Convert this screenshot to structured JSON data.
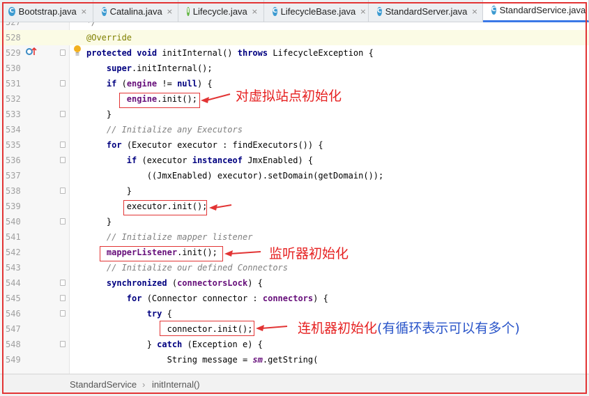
{
  "tabs": [
    {
      "label": "Bootstrap.java",
      "kind": "class"
    },
    {
      "label": "Catalina.java",
      "kind": "class"
    },
    {
      "label": "Lifecycle.java",
      "kind": "interface"
    },
    {
      "label": "LifecycleBase.java",
      "kind": "class"
    },
    {
      "label": "StandardServer.java",
      "kind": "class"
    },
    {
      "label": "StandardService.java",
      "kind": "class",
      "active": true
    }
  ],
  "lines": [
    {
      "n": "527",
      "html": "<span class=\"cm\">*/</span>"
    },
    {
      "n": "528",
      "html": "<span class=\"an\">@Override</span>",
      "hl": true
    },
    {
      "n": "529",
      "html": "<span class=\"kw\">protected void</span> initInternal() <span class=\"kw\">throws</span> LifecycleException {"
    },
    {
      "n": "530",
      "html": "    <span class=\"kw\">super</span>.initInternal();"
    },
    {
      "n": "531",
      "html": "    <span class=\"kw\">if</span> (<span class=\"fd\">engine</span> != <span class=\"kw\">null</span>) {"
    },
    {
      "n": "532",
      "html": "        <span class=\"fd\">engine</span>.init();"
    },
    {
      "n": "533",
      "html": "    }"
    },
    {
      "n": "534",
      "html": "    <span class=\"cm\">// Initialize any Executors</span>"
    },
    {
      "n": "535",
      "html": "    <span class=\"kw\">for</span> (Executor executor : findExecutors()) {"
    },
    {
      "n": "536",
      "html": "        <span class=\"kw\">if</span> (executor <span class=\"kw\">instanceof</span> JmxEnabled) {"
    },
    {
      "n": "537",
      "html": "            ((JmxEnabled) executor).setDomain(getDomain());"
    },
    {
      "n": "538",
      "html": "        }"
    },
    {
      "n": "539",
      "html": "        executor.init();"
    },
    {
      "n": "540",
      "html": "    }"
    },
    {
      "n": "541",
      "html": "    <span class=\"cm\">// Initialize mapper listener</span>"
    },
    {
      "n": "542",
      "html": "    <span class=\"fd\">mapperListener</span>.init();"
    },
    {
      "n": "543",
      "html": "    <span class=\"cm\">// Initialize our defined Connectors</span>"
    },
    {
      "n": "544",
      "html": "    <span class=\"kw\">synchronized</span> (<span class=\"fd\">connectorsLock</span>) {"
    },
    {
      "n": "545",
      "html": "        <span class=\"kw\">for</span> (Connector connector : <span class=\"fd\">connectors</span>) {"
    },
    {
      "n": "546",
      "html": "            <span class=\"kw\">try</span> {"
    },
    {
      "n": "547",
      "html": "                connector.init();"
    },
    {
      "n": "548",
      "html": "            } <span class=\"kw\">catch</span> (Exception e) {"
    },
    {
      "n": "549",
      "html": "                String message = <span class=\"fd it\">sm</span>.getString("
    }
  ],
  "annotations": {
    "engine": "对虚拟站点初始化",
    "mapper": "监听器初始化",
    "connector_red": "连机器初始化",
    "connector_blue": "(有循环表示可以有多个)"
  },
  "breadcrumb": {
    "class_name": "StandardService",
    "separator": "›",
    "method": "initInternal()"
  }
}
